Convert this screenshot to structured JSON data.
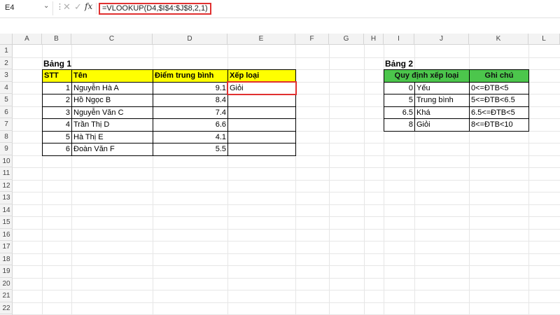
{
  "name_box": {
    "value": "E4",
    "dropdown": "⌄"
  },
  "formula_bar": {
    "kebab": "⋮",
    "cancel": "✕",
    "enter": "✓",
    "fx": "fx",
    "formula": "=VLOOKUP(D4,$I$4:$J$8,2,1)"
  },
  "columns": [
    "A",
    "B",
    "C",
    "D",
    "E",
    "F",
    "G",
    "H",
    "I",
    "J",
    "K",
    "L"
  ],
  "rows": [
    "1",
    "2",
    "3",
    "4",
    "5",
    "6",
    "7",
    "8",
    "9",
    "10",
    "11",
    "12",
    "13",
    "14",
    "15",
    "16",
    "17",
    "18",
    "19",
    "20",
    "21",
    "22"
  ],
  "table1": {
    "title": "Bảng 1",
    "headers": [
      "STT",
      "Tên",
      "Điểm trung bình",
      "Xếp loại"
    ],
    "rows": [
      [
        "1",
        "Nguyễn Hà A",
        "9.1",
        "Giỏi"
      ],
      [
        "2",
        "Hồ Ngọc B",
        "8.4",
        ""
      ],
      [
        "3",
        "Nguyễn Văn C",
        "7.4",
        ""
      ],
      [
        "4",
        "Trần Thị D",
        "6.6",
        ""
      ],
      [
        "5",
        "Hà Thị E",
        "4.1",
        ""
      ],
      [
        "6",
        "Đoàn Văn F",
        "5.5",
        ""
      ]
    ]
  },
  "table2": {
    "title": "Bảng 2",
    "headers": [
      "Quy định xếp loại",
      "Ghi chú"
    ],
    "rows": [
      [
        "0",
        "Yếu",
        "0<=ĐTB<5"
      ],
      [
        "5",
        "Trung bình",
        "5<=ĐTB<6.5"
      ],
      [
        "6.5",
        "Khá",
        "6.5<=ĐTB<5"
      ],
      [
        "8",
        "Giỏi",
        "8<=ĐTB<10"
      ]
    ]
  },
  "colors": {
    "header_yellow": "#ffff00",
    "header_green": "#4cc64c",
    "selection_red": "#e03030"
  }
}
